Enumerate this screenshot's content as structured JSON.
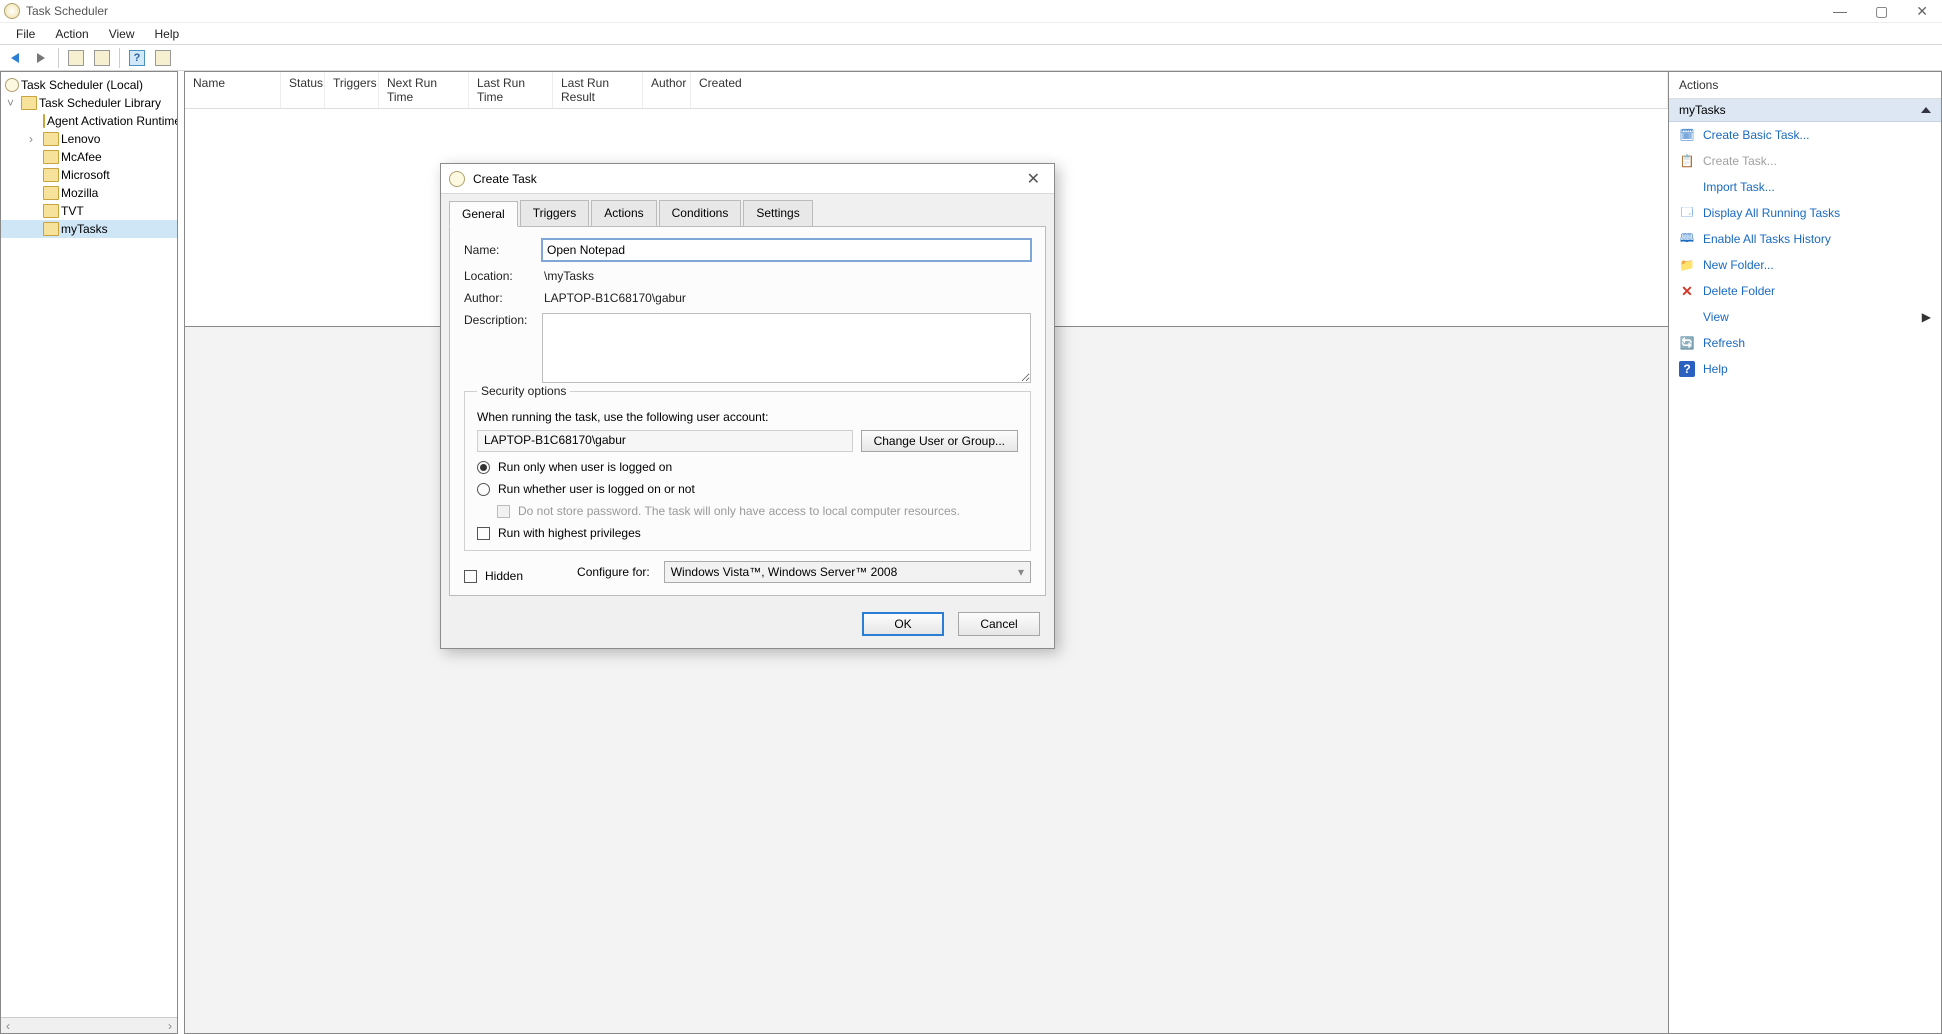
{
  "window": {
    "title": "Task Scheduler"
  },
  "menu": {
    "file": "File",
    "action": "Action",
    "view": "View",
    "help": "Help"
  },
  "tree": {
    "root": "Task Scheduler (Local)",
    "library": "Task Scheduler Library",
    "items": [
      "Agent Activation Runtime",
      "Lenovo",
      "McAfee",
      "Microsoft",
      "Mozilla",
      "TVT",
      "myTasks"
    ]
  },
  "list": {
    "cols": {
      "name": "Name",
      "status": "Status",
      "triggers": "Triggers",
      "next": "Next Run Time",
      "last": "Last Run Time",
      "result": "Last Run Result",
      "author": "Author",
      "created": "Created"
    }
  },
  "actions": {
    "title": "Actions",
    "section": "myTasks",
    "items": {
      "create_basic": "Create Basic Task...",
      "create_task": "Create Task...",
      "import": "Import Task...",
      "display_running": "Display All Running Tasks",
      "enable_history": "Enable All Tasks History",
      "new_folder": "New Folder...",
      "delete_folder": "Delete Folder",
      "view": "View",
      "refresh": "Refresh",
      "help": "Help"
    }
  },
  "dialog": {
    "title": "Create Task",
    "tabs": {
      "general": "General",
      "triggers": "Triggers",
      "actions": "Actions",
      "conditions": "Conditions",
      "settings": "Settings"
    },
    "labels": {
      "name": "Name:",
      "location": "Location:",
      "author": "Author:",
      "description": "Description:"
    },
    "name_value": "Open Notepad",
    "location_value": "\\myTasks",
    "author_value": "LAPTOP-B1C68170\\gabur",
    "security": {
      "legend": "Security options",
      "when_running": "When running the task, use the following user account:",
      "user_account": "LAPTOP-B1C68170\\gabur",
      "change_user": "Change User or Group...",
      "run_logged_on": "Run only when user is logged on",
      "run_whether": "Run whether user is logged on or not",
      "no_store_pwd": "Do not store password.  The task will only have access to local computer resources.",
      "highest_priv": "Run with highest privileges"
    },
    "hidden": "Hidden",
    "configure_for_label": "Configure for:",
    "configure_for_value": "Windows Vista™, Windows Server™ 2008",
    "ok": "OK",
    "cancel": "Cancel"
  }
}
